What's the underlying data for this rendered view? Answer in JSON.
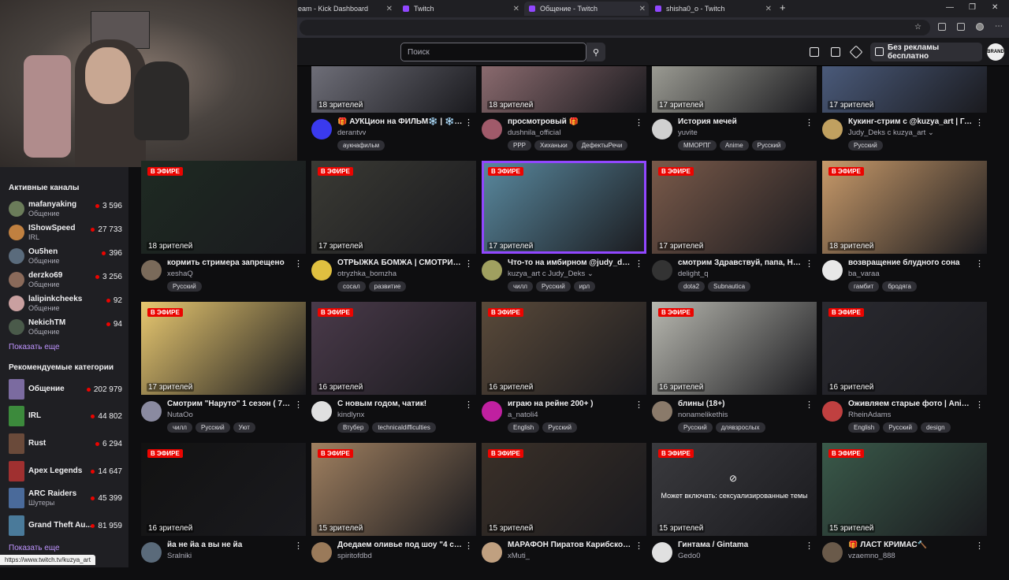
{
  "browser": {
    "tabs": [
      {
        "label": "eam - Kick Dashboard"
      },
      {
        "label": "Twitch"
      },
      {
        "label": "Общение - Twitch"
      },
      {
        "label": "shisha0_o - Twitch"
      }
    ]
  },
  "nav": {
    "search_placeholder": "Поиск",
    "ad_free_label": "Без рекламы бесплатно",
    "avatar_label": "BRAND"
  },
  "sidebar": {
    "active_header": "Активные каналы",
    "channels": [
      {
        "name": "mafanyaking",
        "category": "Общение",
        "viewers": "3 596",
        "color": "#6b7c5a"
      },
      {
        "name": "IShowSpeed",
        "category": "IRL",
        "viewers": "27 733",
        "color": "#c08040"
      },
      {
        "name": "Ou5hen",
        "category": "Общение",
        "viewers": "396",
        "color": "#5a6b7c"
      },
      {
        "name": "derzko69",
        "category": "Общение",
        "viewers": "3 256",
        "color": "#8a6a5a"
      },
      {
        "name": "lalipinkcheeks",
        "category": "Общение",
        "viewers": "92",
        "color": "#c9a0a0"
      },
      {
        "name": "NekichTM",
        "category": "Общение",
        "viewers": "94",
        "color": "#4a5a4a"
      }
    ],
    "show_more": "Показать еще",
    "rec_header": "Рекомендуемые категории",
    "categories": [
      {
        "name": "Общение",
        "sub": "",
        "viewers": "202 979",
        "color": "#7b6ba0"
      },
      {
        "name": "IRL",
        "sub": "",
        "viewers": "44 802",
        "color": "#3c8a3c"
      },
      {
        "name": "Rust",
        "sub": "",
        "viewers": "6 294",
        "color": "#6a4a3a"
      },
      {
        "name": "Apex Legends",
        "sub": "",
        "viewers": "14 647",
        "color": "#a03030"
      },
      {
        "name": "ARC Raiders",
        "sub": "Шутеры",
        "viewers": "45 399",
        "color": "#4a6a9a"
      },
      {
        "name": "Grand Theft Au...",
        "sub": "",
        "viewers": "81 959",
        "color": "#4a7a9a"
      }
    ],
    "show_more2": "Показать еще"
  },
  "status_url": "https://www.twitch.tv/kuzya_art",
  "live_label": "В ЭФИРЕ",
  "streams": [
    {
      "live": false,
      "viewers": "18 зрителей",
      "title": "🎁 АУКЦион на ФИЛЬМ❄️ | ❄️ В !...",
      "channel": "derantvv",
      "tags": [
        "аукнафильм"
      ],
      "thumb": "#6e6e78",
      "avatar": "#3a3aee"
    },
    {
      "live": false,
      "viewers": "18 зрителей",
      "title": "просмотровый 🎁",
      "channel": "dushnila_official",
      "tags": [
        "PPP",
        "Хиханьки",
        "ДефектыРечи"
      ],
      "thumb": "#8a6a6e",
      "avatar": "#a05a6a"
    },
    {
      "live": false,
      "viewers": "17 зрителей",
      "title": "История мечей",
      "channel": "yuvite",
      "tags": [
        "ММОРПГ",
        "Anime",
        "Русский"
      ],
      "thumb": "#9a9a92",
      "avatar": "#d0d0d0"
    },
    {
      "live": false,
      "viewers": "17 зрителей",
      "title": "Кукинг-стрим с @kuzya_art | Гот...",
      "channel": "Judy_Deks с kuzya_art ⌄",
      "tags": [
        "Русский"
      ],
      "thumb": "#4a5a7a",
      "avatar": "#c0a060"
    },
    {
      "live": true,
      "viewers": "18 зрителей",
      "title": "кормить стримера запрещено",
      "channel": "xeshaQ",
      "tags": [
        "Русский"
      ],
      "thumb": "#1e2a22",
      "avatar": "#7a6a5a"
    },
    {
      "live": true,
      "viewers": "17 зрителей",
      "title": "ОТРЫЖКА БОМЖА | СМОТРИМ ...",
      "channel": "otryzhka_bomzha",
      "tags": [
        "сосал",
        "развитие"
      ],
      "thumb": "#3a3a34",
      "avatar": "#e0c040"
    },
    {
      "live": true,
      "viewers": "17 зрителей",
      "title": "Что-то на имбирном @judy_deks",
      "channel": "kuzya_art с Judy_Deks ⌄",
      "tags": [
        "чилл",
        "Русский",
        "ирл"
      ],
      "thumb": "#5a8aa0",
      "avatar": "#a0a060",
      "selected": true
    },
    {
      "live": true,
      "viewers": "17 зрителей",
      "title": "смотрим Здравствуй, папа, Нов...",
      "channel": "delight_q",
      "tags": [
        "dota2",
        "Subnautica"
      ],
      "thumb": "#7a5a4a",
      "avatar": "#333333"
    },
    {
      "live": true,
      "viewers": "18 зрителей",
      "title": "возвращение блудного сона",
      "channel": "ba_varaa",
      "tags": [
        "гамбит",
        "бродяга"
      ],
      "thumb": "#c89a6a",
      "avatar": "#e8e8e8"
    },
    {
      "live": true,
      "viewers": "17 зрителей",
      "title": "Смотрим \"Наруто\" 1 сезон ( 74-8...",
      "channel": "NutaOo",
      "tags": [
        "чилл",
        "Русский",
        "Уют"
      ],
      "thumb": "#e8c870",
      "avatar": "#8a8aa0"
    },
    {
      "live": true,
      "viewers": "16 зрителей",
      "title": "С новым годом, чатик!",
      "channel": "kindlynx",
      "tags": [
        "Втубер",
        "technicaldifficulties"
      ],
      "thumb": "#4a3a4a",
      "avatar": "#e0e0e0"
    },
    {
      "live": true,
      "viewers": "16 зрителей",
      "title": "играю на рейне 200+ )",
      "channel": "a_natoli4",
      "tags": [
        "English",
        "Русский"
      ],
      "thumb": "#5a4a3a",
      "avatar": "#c020a0"
    },
    {
      "live": true,
      "viewers": "16 зрителей",
      "title": "блины (18+)",
      "channel": "nonamelikethis",
      "tags": [
        "Русский",
        "длявзрослых"
      ],
      "thumb": "#b8b8b0",
      "avatar": "#8a7a6a"
    },
    {
      "live": true,
      "viewers": "16 зрителей",
      "title": "Оживляем старые фото | Animat...",
      "channel": "RheinAdams",
      "tags": [
        "English",
        "Русский",
        "design"
      ],
      "thumb": "#2a2a30",
      "avatar": "#c04040"
    },
    {
      "live": true,
      "viewers": "16 зрителей",
      "title": "йа не йа а вы не йа",
      "channel": "Sralniki",
      "tags": [],
      "thumb": "#121212",
      "avatar": "#5a6a7a"
    },
    {
      "live": true,
      "viewers": "15 зрителей",
      "title": "Доедаем оливье под шоу \"4 сва...",
      "channel": "spiritofdbd",
      "tags": [],
      "thumb": "#a08060",
      "avatar": "#9a7a5a"
    },
    {
      "live": true,
      "viewers": "15 зрителей",
      "title": "МАРАФОН Пиратов Карибского...",
      "channel": "xMuti_",
      "tags": [],
      "thumb": "#3a3028",
      "avatar": "#c0a080"
    },
    {
      "live": true,
      "viewers": "15 зрителей",
      "title": "Гинтама / Gintama",
      "channel": "Gedo0",
      "tags": [],
      "thumb": "#3a3a3e",
      "avatar": "#e0e0e0",
      "warning": "Может включать: сексуализированные темы"
    },
    {
      "live": true,
      "viewers": "15 зрителей",
      "title": "🎁 ЛАСТ КРИМАС🔨",
      "channel": "vzaemno_888",
      "tags": [],
      "thumb": "#3a5a4a",
      "avatar": "#6a5a4a"
    }
  ]
}
